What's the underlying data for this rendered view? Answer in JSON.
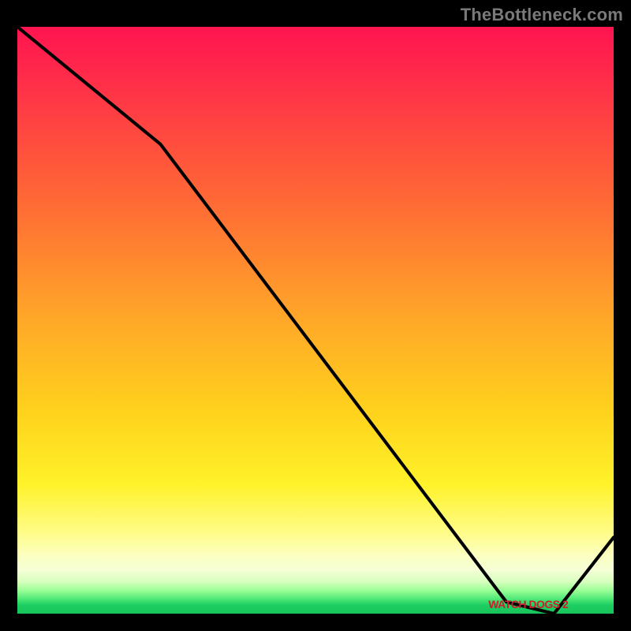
{
  "watermark": "TheBottleneck.com",
  "marker_label": "WATCH DOGS 2",
  "chart_data": {
    "type": "line",
    "title": "",
    "xlabel": "",
    "ylabel": "",
    "xlim": [
      0,
      100
    ],
    "ylim": [
      0,
      100
    ],
    "grid": false,
    "legend": false,
    "x": [
      0,
      24,
      82,
      90,
      100
    ],
    "y": [
      100,
      80,
      2,
      0,
      13
    ],
    "notes": "x is normalized plot-area width %, y is normalized plot-area height % (0 at bottom, 100 at top). Curve starts top-left, slight bend ~24% in, descends nearly linearly to a minimum near x≈88%, then rises toward the right edge. Minimum sits on the green band and is annotated with marker_label."
  },
  "colors": {
    "line": "#000000",
    "marker_text": "#d11a2a",
    "background_top": "#ff1450",
    "background_mid": "#ffd31c",
    "background_bottom": "#17c45c",
    "frame": "#000000",
    "watermark": "#7a7a7a"
  }
}
